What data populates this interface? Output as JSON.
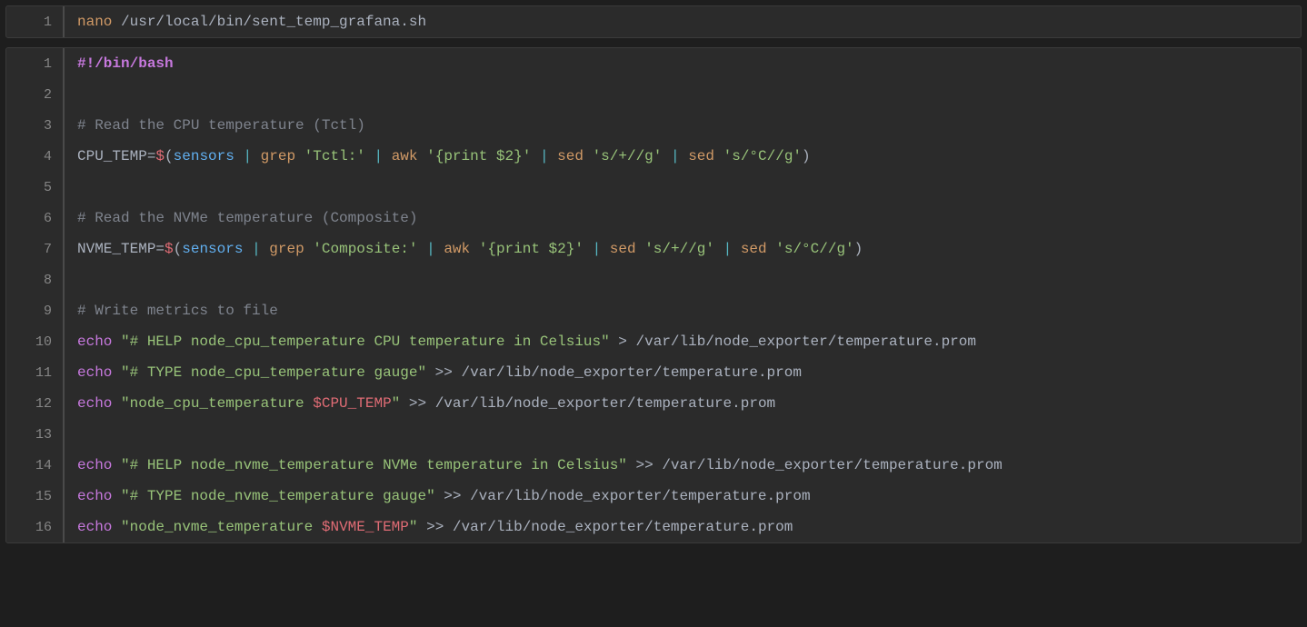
{
  "block1": {
    "lines": [
      {
        "num": "1",
        "tokens": [
          {
            "cls": "tok-cmd",
            "t": "nano"
          },
          {
            "cls": "tok-path",
            "t": " /usr/local/bin/sent_temp_grafana.sh"
          }
        ]
      }
    ]
  },
  "block2": {
    "lines": [
      {
        "num": "1",
        "tokens": [
          {
            "cls": "tok-shebang",
            "t": "#!/bin/bash"
          }
        ]
      },
      {
        "num": "2",
        "tokens": []
      },
      {
        "num": "3",
        "tokens": [
          {
            "cls": "tok-comment",
            "t": "# Read the CPU temperature (Tctl)"
          }
        ]
      },
      {
        "num": "4",
        "tokens": [
          {
            "cls": "tok-var",
            "t": "CPU_TEMP"
          },
          {
            "cls": "tok-eq",
            "t": "="
          },
          {
            "cls": "tok-dollar",
            "t": "$"
          },
          {
            "cls": "tok-paren",
            "t": "("
          },
          {
            "cls": "tok-fn",
            "t": "sensors"
          },
          {
            "cls": "tok-pipe",
            "t": " | "
          },
          {
            "cls": "tok-cmd",
            "t": "grep"
          },
          {
            "cls": "tok-str",
            "t": " 'Tctl:'"
          },
          {
            "cls": "tok-pipe",
            "t": " | "
          },
          {
            "cls": "tok-cmd",
            "t": "awk"
          },
          {
            "cls": "tok-str",
            "t": " '{print $2}'"
          },
          {
            "cls": "tok-pipe",
            "t": " | "
          },
          {
            "cls": "tok-cmd",
            "t": "sed"
          },
          {
            "cls": "tok-str",
            "t": " 's/+//g'"
          },
          {
            "cls": "tok-pipe",
            "t": " | "
          },
          {
            "cls": "tok-cmd",
            "t": "sed"
          },
          {
            "cls": "tok-str",
            "t": " 's/°C//g'"
          },
          {
            "cls": "tok-paren",
            "t": ")"
          }
        ]
      },
      {
        "num": "5",
        "tokens": []
      },
      {
        "num": "6",
        "tokens": [
          {
            "cls": "tok-comment",
            "t": "# Read the NVMe temperature (Composite)"
          }
        ]
      },
      {
        "num": "7",
        "tokens": [
          {
            "cls": "tok-var",
            "t": "NVME_TEMP"
          },
          {
            "cls": "tok-eq",
            "t": "="
          },
          {
            "cls": "tok-dollar",
            "t": "$"
          },
          {
            "cls": "tok-paren",
            "t": "("
          },
          {
            "cls": "tok-fn",
            "t": "sensors"
          },
          {
            "cls": "tok-pipe",
            "t": " | "
          },
          {
            "cls": "tok-cmd",
            "t": "grep"
          },
          {
            "cls": "tok-str",
            "t": " 'Composite:'"
          },
          {
            "cls": "tok-pipe",
            "t": " | "
          },
          {
            "cls": "tok-cmd",
            "t": "awk"
          },
          {
            "cls": "tok-str",
            "t": " '{print $2}'"
          },
          {
            "cls": "tok-pipe",
            "t": " | "
          },
          {
            "cls": "tok-cmd",
            "t": "sed"
          },
          {
            "cls": "tok-str",
            "t": " 's/+//g'"
          },
          {
            "cls": "tok-pipe",
            "t": " | "
          },
          {
            "cls": "tok-cmd",
            "t": "sed"
          },
          {
            "cls": "tok-str",
            "t": " 's/°C//g'"
          },
          {
            "cls": "tok-paren",
            "t": ")"
          }
        ]
      },
      {
        "num": "8",
        "tokens": []
      },
      {
        "num": "9",
        "tokens": [
          {
            "cls": "tok-comment",
            "t": "# Write metrics to file"
          }
        ]
      },
      {
        "num": "10",
        "tokens": [
          {
            "cls": "tok-kw",
            "t": "echo"
          },
          {
            "cls": "tok-op",
            "t": " "
          },
          {
            "cls": "tok-str",
            "t": "\"# HELP node_cpu_temperature CPU temperature in Celsius\""
          },
          {
            "cls": "tok-op",
            "t": " > /var/lib/node_exporter/temperature.prom"
          }
        ]
      },
      {
        "num": "11",
        "tokens": [
          {
            "cls": "tok-kw",
            "t": "echo"
          },
          {
            "cls": "tok-op",
            "t": " "
          },
          {
            "cls": "tok-str",
            "t": "\"# TYPE node_cpu_temperature gauge\""
          },
          {
            "cls": "tok-op",
            "t": " >> /var/lib/node_exporter/temperature.prom"
          }
        ]
      },
      {
        "num": "12",
        "tokens": [
          {
            "cls": "tok-kw",
            "t": "echo"
          },
          {
            "cls": "tok-op",
            "t": " "
          },
          {
            "cls": "tok-str",
            "t": "\"node_cpu_temperature "
          },
          {
            "cls": "tok-varref",
            "t": "$CPU_TEMP"
          },
          {
            "cls": "tok-str",
            "t": "\""
          },
          {
            "cls": "tok-op",
            "t": " >> /var/lib/node_exporter/temperature.prom"
          }
        ]
      },
      {
        "num": "13",
        "tokens": []
      },
      {
        "num": "14",
        "tokens": [
          {
            "cls": "tok-kw",
            "t": "echo"
          },
          {
            "cls": "tok-op",
            "t": " "
          },
          {
            "cls": "tok-str",
            "t": "\"# HELP node_nvme_temperature NVMe temperature in Celsius\""
          },
          {
            "cls": "tok-op",
            "t": " >> /var/lib/node_exporter/temperature.prom"
          }
        ]
      },
      {
        "num": "15",
        "tokens": [
          {
            "cls": "tok-kw",
            "t": "echo"
          },
          {
            "cls": "tok-op",
            "t": " "
          },
          {
            "cls": "tok-str",
            "t": "\"# TYPE node_nvme_temperature gauge\""
          },
          {
            "cls": "tok-op",
            "t": " >> /var/lib/node_exporter/temperature.prom"
          }
        ]
      },
      {
        "num": "16",
        "tokens": [
          {
            "cls": "tok-kw",
            "t": "echo"
          },
          {
            "cls": "tok-op",
            "t": " "
          },
          {
            "cls": "tok-str",
            "t": "\"node_nvme_temperature "
          },
          {
            "cls": "tok-varref",
            "t": "$NVME_TEMP"
          },
          {
            "cls": "tok-str",
            "t": "\""
          },
          {
            "cls": "tok-op",
            "t": " >> /var/lib/node_exporter/temperature.prom"
          }
        ]
      }
    ]
  }
}
